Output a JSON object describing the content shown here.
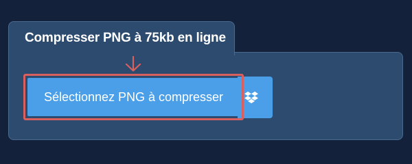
{
  "card": {
    "title": "Compresser PNG à 75kb en ligne"
  },
  "upload": {
    "select_label": "Sélectionnez PNG à compresser",
    "dropbox_icon": "dropbox-icon"
  },
  "colors": {
    "page_background": "#13223a",
    "card_background": "#2d4b6e",
    "button_primary": "#4a9fe8",
    "highlight_annotation": "#d9605e"
  }
}
